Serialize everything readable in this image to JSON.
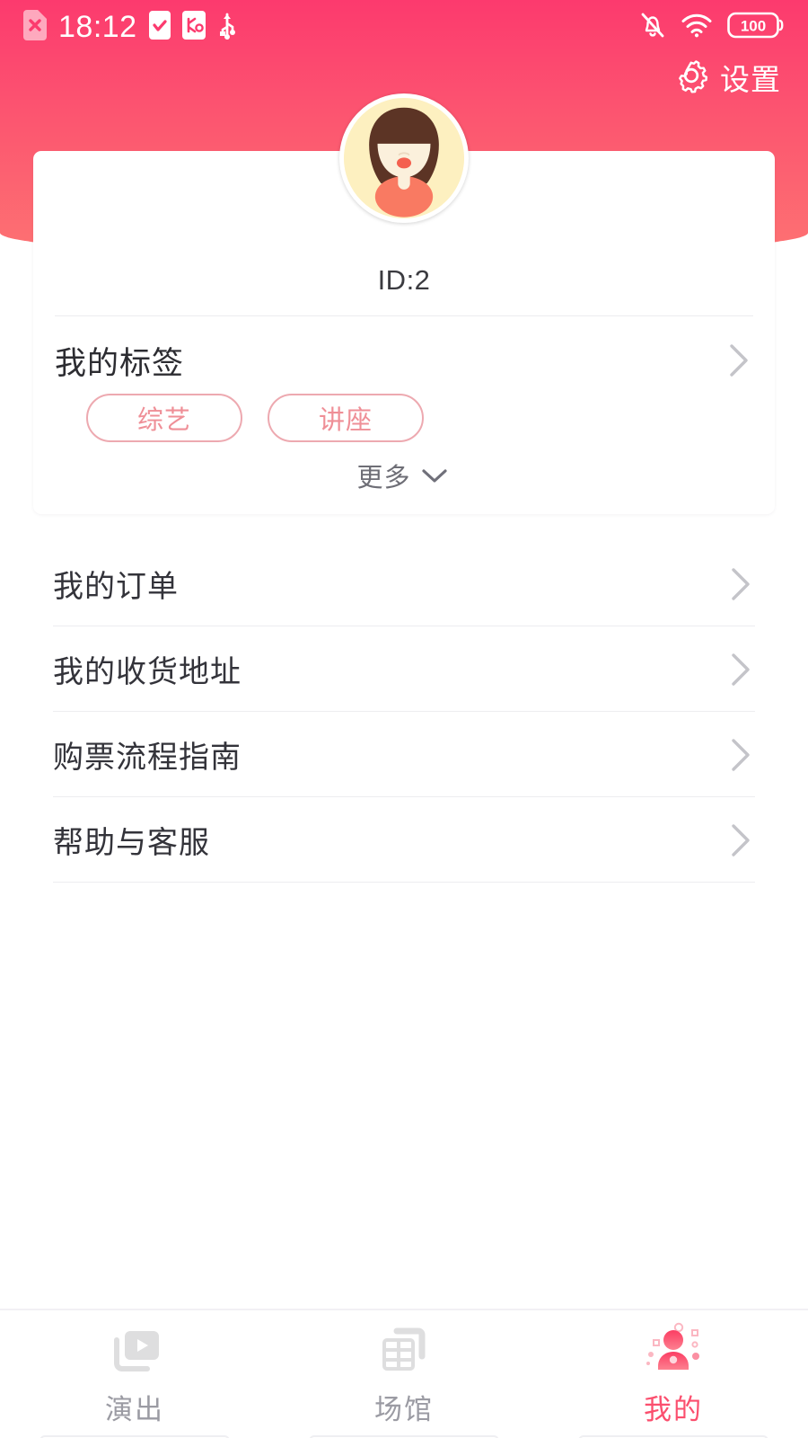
{
  "theme": {
    "accent": "#fb4f6e",
    "header_gradient_top": "#fc3a6e",
    "header_gradient_bottom": "#fd7272",
    "tag_border": "#eda9b0",
    "tag_text": "#ef8f97",
    "text_primary": "#33333a",
    "text_muted": "#9b9ba3",
    "divider": "#ededf0",
    "page_bg": "#ffffff"
  },
  "status_bar": {
    "time": "18:12",
    "battery_level": "100",
    "left_icons": [
      "sim-error-icon",
      "task-check-icon",
      "debug-icon",
      "usb-icon"
    ],
    "right_icons": [
      "bell-muted-icon",
      "wifi-icon",
      "battery-icon"
    ]
  },
  "header": {
    "settings_label": "设置",
    "settings_icon": "gear-icon",
    "avatar_icon": "user-avatar-girl"
  },
  "profile_card": {
    "user_id": "ID:2",
    "tags_section": {
      "title": "我的标签",
      "chevron_icon": "chevron-right-icon",
      "tags": [
        {
          "label": "综艺"
        },
        {
          "label": "讲座"
        }
      ],
      "more_label": "更多",
      "more_icon": "chevron-down-icon"
    }
  },
  "menu": {
    "items": [
      {
        "label": "我的订单",
        "icon": "chevron-right-icon"
      },
      {
        "label": "我的收货地址",
        "icon": "chevron-right-icon"
      },
      {
        "label": "购票流程指南",
        "icon": "chevron-right-icon"
      },
      {
        "label": "帮助与客服",
        "icon": "chevron-right-icon"
      }
    ]
  },
  "bottom_nav": {
    "items": [
      {
        "label": "演出",
        "icon": "video-play-icon",
        "active": false
      },
      {
        "label": "场馆",
        "icon": "venue-grid-icon",
        "active": false
      },
      {
        "label": "我的",
        "icon": "user-profile-icon",
        "active": true
      }
    ]
  }
}
